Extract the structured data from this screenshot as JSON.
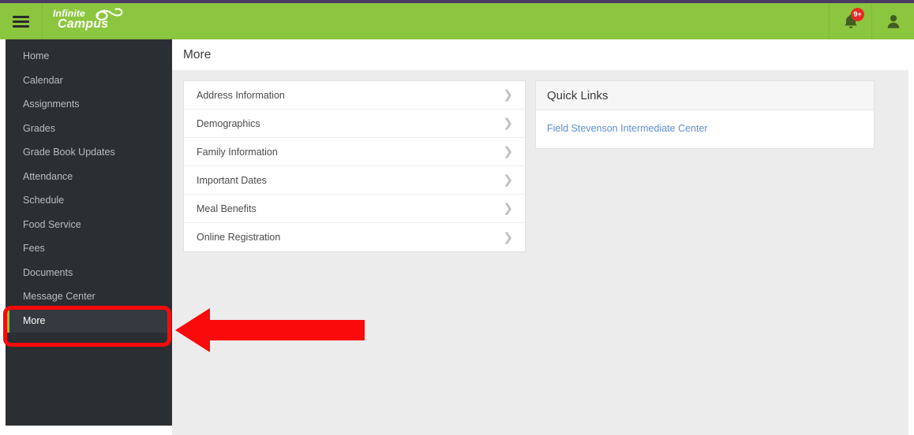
{
  "app": {
    "brand_top": "Infinite",
    "brand_bottom": "Campus",
    "brand_swoosh_icon": "infinity-swoosh-icon",
    "menu_icon": "hamburger-menu-icon",
    "header_color": "#8cc63f",
    "top_strip_color": "#4b3b63"
  },
  "header": {
    "notifications": {
      "icon": "bell-icon",
      "badge": "9+",
      "badge_color": "#e22b24"
    },
    "account": {
      "icon": "user-account-icon"
    }
  },
  "sidebar": {
    "background": "#2b2f33",
    "active_indicator_color": "#8cc63f",
    "items": [
      {
        "label": "Home",
        "active": false
      },
      {
        "label": "Calendar",
        "active": false
      },
      {
        "label": "Assignments",
        "active": false
      },
      {
        "label": "Grades",
        "active": false
      },
      {
        "label": "Grade Book Updates",
        "active": false
      },
      {
        "label": "Attendance",
        "active": false
      },
      {
        "label": "Schedule",
        "active": false
      },
      {
        "label": "Food Service",
        "active": false
      },
      {
        "label": "Fees",
        "active": false
      },
      {
        "label": "Documents",
        "active": false
      },
      {
        "label": "Message Center",
        "active": false
      },
      {
        "label": "More",
        "active": true
      }
    ]
  },
  "main": {
    "page_title": "More",
    "list_items": [
      {
        "label": "Address Information",
        "chevron": "chevron-right-icon"
      },
      {
        "label": "Demographics",
        "chevron": "chevron-right-icon"
      },
      {
        "label": "Family Information",
        "chevron": "chevron-right-icon"
      },
      {
        "label": "Important Dates",
        "chevron": "chevron-right-icon"
      },
      {
        "label": "Meal Benefits",
        "chevron": "chevron-right-icon"
      },
      {
        "label": "Online Registration",
        "chevron": "chevron-right-icon"
      }
    ],
    "quick_links": {
      "title": "Quick Links",
      "links": [
        {
          "label": "Field Stevenson Intermediate Center",
          "color": "#5b8fd4"
        }
      ]
    }
  },
  "annotations": {
    "color": "#fa0a0a",
    "highlight_target": "More",
    "arrow_direction": "left",
    "rectangle_icon": "highlight-rectangle",
    "arrow_icon": "pointer-arrow-left"
  }
}
